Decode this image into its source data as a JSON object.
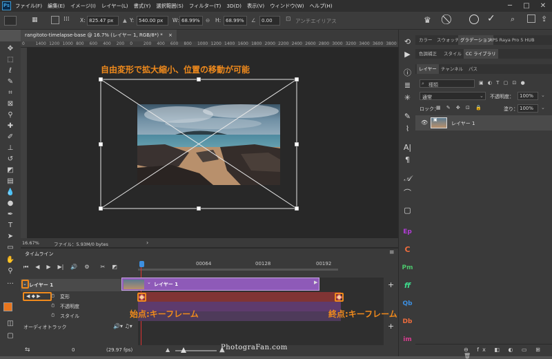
{
  "menubar": {
    "logo": "Ps",
    "items": [
      "ファイル(F)",
      "編集(E)",
      "イメージ(I)",
      "レイヤー(L)",
      "書式(Y)",
      "選択範囲(S)",
      "フィルター(T)",
      "3D(D)",
      "表示(V)",
      "ウィンドウ(W)",
      "ヘルプ(H)"
    ],
    "win_min": "─",
    "win_max": "□",
    "win_close": "✕"
  },
  "options": {
    "x_label": "X:",
    "x_value": "825.47 px",
    "y_label": "Y:",
    "y_value": "540.00 px",
    "w_label": "W:",
    "w_value": "68.99%",
    "h_label": "H:",
    "h_value": "68.99%",
    "angle_value": "0.00",
    "antialias_label": "アンチエイリアス"
  },
  "document": {
    "tab_title": "rangitoto-timelapse-base @ 16.7% (レイヤー 1, RGB/8*) *",
    "tab_close": "×",
    "ruler_ticks": [
      "0",
      "1400",
      "1200",
      "1000",
      "800",
      "600",
      "400",
      "200",
      "0",
      "200",
      "400",
      "600",
      "800",
      "1000",
      "1200",
      "1400",
      "1600",
      "1800",
      "2000",
      "2200",
      "2400",
      "2600",
      "2800",
      "3000",
      "3200",
      "3400",
      "3600",
      "3800"
    ],
    "annotation": "自由変形で拡大縮小、位置の移動が可能"
  },
  "status": {
    "zoom": "16.67%",
    "file_info": "ファイル：5.93M/0 bytes",
    "arrow": "›"
  },
  "timeline": {
    "title": "タイムライン",
    "ruler_labels": [
      "00064",
      "00128",
      "00192"
    ],
    "layer_name": "レイヤー 1",
    "clip_label": "レイヤー 1",
    "properties": [
      "変形",
      "不透明度",
      "スタイル"
    ],
    "audio_track": "オーディオトラック",
    "frame_counter": "0",
    "fps": "(29.97 fps)",
    "start_annotation": "始点:キーフレーム",
    "end_annotation": "終点:キーフレーム",
    "add_label": "+"
  },
  "panels": {
    "tabs_row1": [
      "カラー",
      "スウォッチ",
      "グラデーション",
      "RPS Raya Pro 5 HUB"
    ],
    "tabs_row2": [
      "色調補正",
      "スタイル",
      "CC ライブラリ"
    ],
    "tabs_row3": [
      "レイヤー",
      "チャンネル",
      "パス"
    ],
    "search_placeholder": "種類",
    "blend_mode": "通常",
    "opacity_label": "不透明度：",
    "opacity_value": "100%",
    "lock_label": "ロック：",
    "fill_label": "塗り：",
    "fill_value": "100%",
    "layer_name": "レイヤー 1"
  },
  "right_column_icons": [
    "Ep",
    "C",
    "Pm",
    "ff",
    "Qb",
    "Db",
    "im"
  ],
  "watermark": "PhotograFan.com"
}
